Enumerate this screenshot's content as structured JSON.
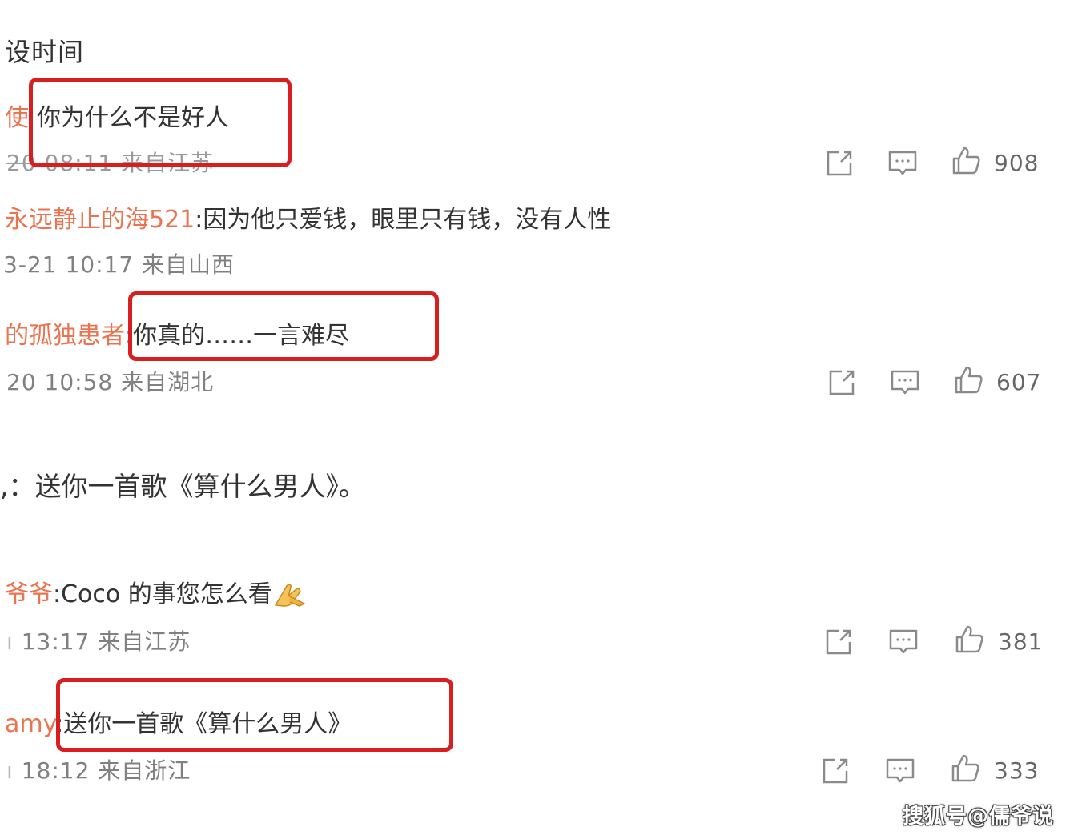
{
  "header": {
    "title": "设时间"
  },
  "comments": [
    {
      "username": "使",
      "text": "你为什么不是好人",
      "meta": "20 08:11 来自江苏",
      "like_count": "908"
    },
    {
      "username": "永远静止的海521",
      "text": ":因为他只爱钱，眼里只有钱，没有人性",
      "meta": "3-21 10:17 来自山西"
    },
    {
      "username": "的孤独患者",
      "text": ":你真的……一言难尽",
      "meta": "20 10:58 来自湖北",
      "like_count": "607"
    },
    {
      "username": "",
      "text": ",：送你一首歌《算什么男人》。",
      "meta": ""
    },
    {
      "username": "爷爷",
      "text": ":Coco 的事您怎么看",
      "meta": "13:17 来自江苏",
      "like_count": "381"
    },
    {
      "username": "amy",
      "text": ":送你一首歌《算什么男人》",
      "meta": "18:12 来自浙江",
      "like_count": "333"
    }
  ],
  "icons": {
    "share": "share-icon",
    "comment": "comment-icon",
    "like": "thumbs-up-icon",
    "emoji": "praying-hands-emoji"
  },
  "colors": {
    "username": "#eb7350",
    "highlight_box": "#d81e1e",
    "meta": "#808080",
    "icon": "#8a8a8a"
  },
  "watermark": "搜狐号@儒爷说"
}
